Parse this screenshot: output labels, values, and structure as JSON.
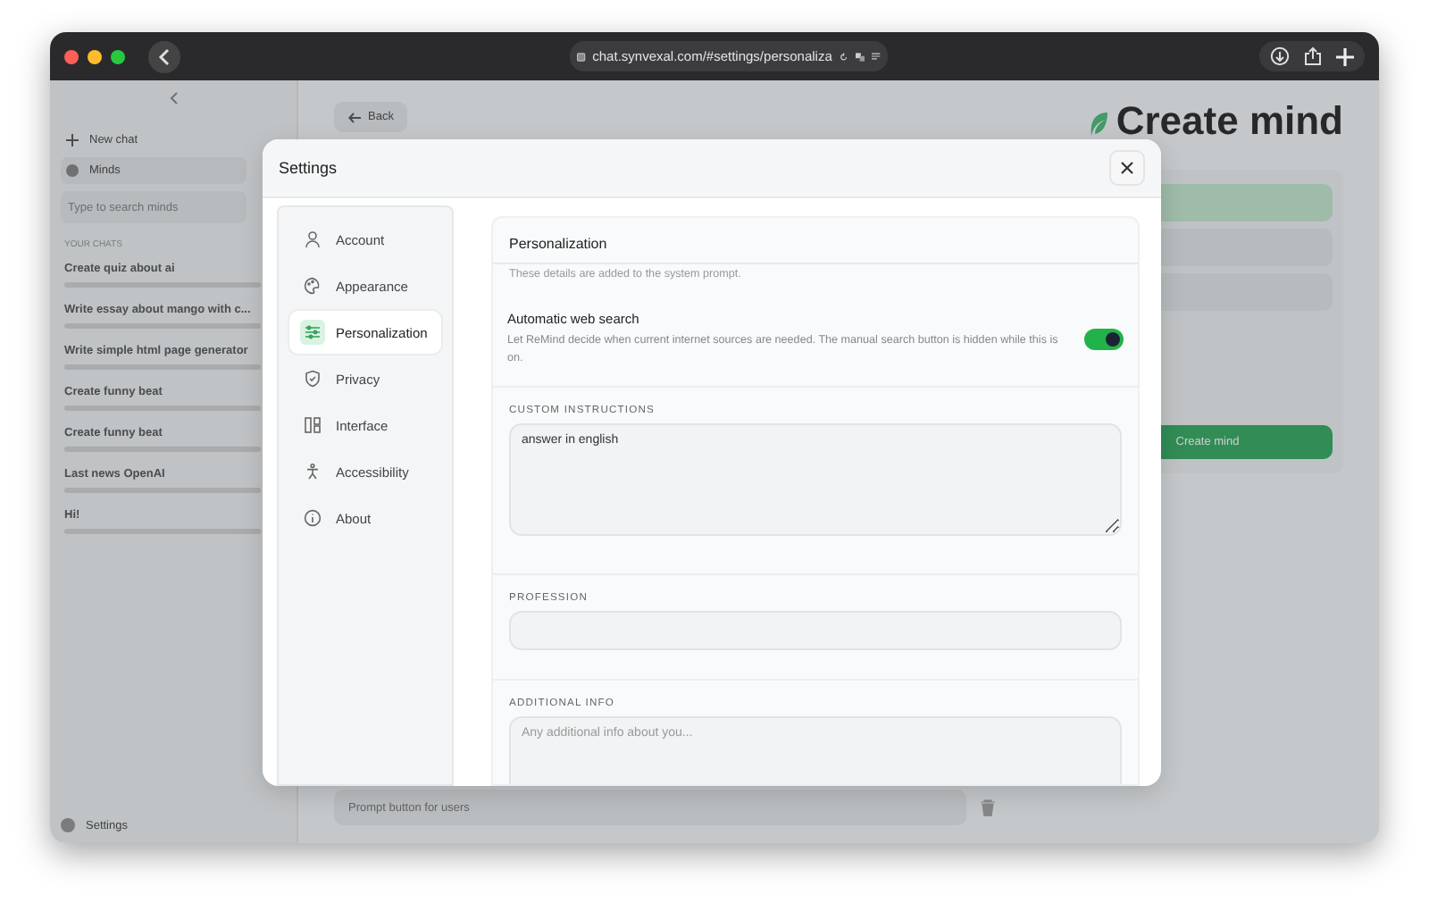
{
  "browser": {
    "url": "chat.synvexal.com/#settings/personaliza"
  },
  "sidebar": {
    "new_chat": "New chat",
    "minds": "Minds",
    "search_placeholder": "Type to search minds",
    "section_title": "YOUR CHATS",
    "chats": [
      {
        "title": "Create quiz about ai"
      },
      {
        "title": "Write essay about mango with c..."
      },
      {
        "title": "Write simple html page generator"
      },
      {
        "title": "Create funny beat"
      },
      {
        "title": "Create funny beat"
      },
      {
        "title": "Last news OpenAI"
      },
      {
        "title": "Hi!"
      }
    ],
    "settings": "Settings"
  },
  "main": {
    "back": "Back",
    "heading": "Create mind",
    "create_button": "Create mind",
    "prompt_field": "Prompt button for users"
  },
  "settings_dialog": {
    "title": "Settings",
    "nav": [
      {
        "label": "Account",
        "selected": false
      },
      {
        "label": "Appearance",
        "selected": false
      },
      {
        "label": "Personalization",
        "selected": true
      },
      {
        "label": "Privacy",
        "selected": false
      },
      {
        "label": "Interface",
        "selected": false
      },
      {
        "label": "Accessibility",
        "selected": false
      },
      {
        "label": "About",
        "selected": false
      }
    ],
    "section": {
      "title": "Personalization",
      "description": "These details are added to the system prompt.",
      "toggle": {
        "label": "Automatic web search",
        "description": "Let ReMind decide when current internet sources are needed. The manual search button is hidden while this is on.",
        "on": true
      },
      "fields": [
        {
          "label": "CUSTOM INSTRUCTIONS",
          "kind": "textarea",
          "value": "answer in english"
        },
        {
          "label": "PROFESSION",
          "kind": "input"
        },
        {
          "label": "ADDITIONAL INFO",
          "kind": "textarea",
          "placeholder": "Any additional info about you..."
        }
      ]
    }
  }
}
